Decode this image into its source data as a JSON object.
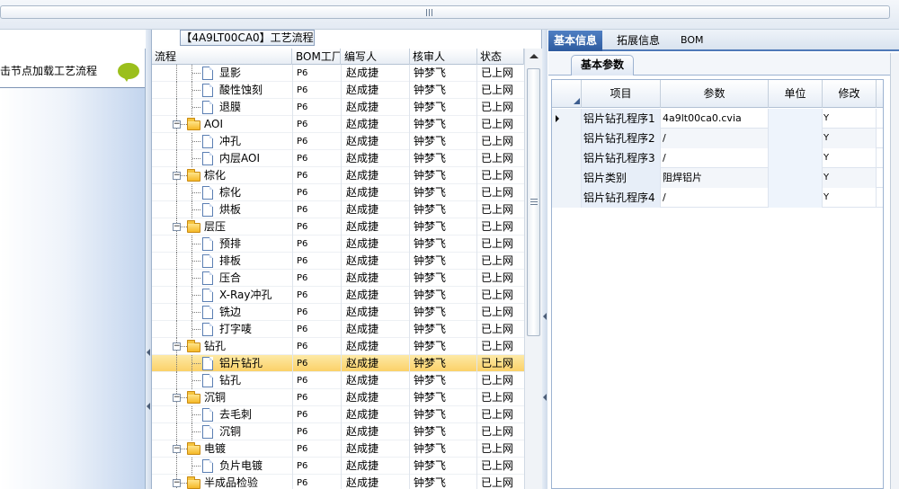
{
  "left": {
    "hint": "击节点加载工艺流程"
  },
  "middle": {
    "title": "【4A9LT00CA0】工艺流程",
    "columns": [
      "流程",
      "BOM工厂",
      "编写人",
      "核审人",
      "状态"
    ],
    "rows": [
      {
        "name": "显影",
        "type": "doc",
        "level": 2,
        "bom": "P6",
        "author": "赵成捷",
        "reviewer": "钟梦飞",
        "status": "已上网"
      },
      {
        "name": "酸性蚀刻",
        "type": "doc",
        "level": 2,
        "bom": "P6",
        "author": "赵成捷",
        "reviewer": "钟梦飞",
        "status": "已上网"
      },
      {
        "name": "退膜",
        "type": "doc",
        "level": 2,
        "bom": "P6",
        "author": "赵成捷",
        "reviewer": "钟梦飞",
        "status": "已上网"
      },
      {
        "name": "AOI",
        "type": "folder",
        "level": 1,
        "bom": "P6",
        "author": "赵成捷",
        "reviewer": "钟梦飞",
        "status": "已上网"
      },
      {
        "name": "冲孔",
        "type": "doc",
        "level": 2,
        "bom": "P6",
        "author": "赵成捷",
        "reviewer": "钟梦飞",
        "status": "已上网"
      },
      {
        "name": "内层AOI",
        "type": "doc",
        "level": 2,
        "bom": "P6",
        "author": "赵成捷",
        "reviewer": "钟梦飞",
        "status": "已上网"
      },
      {
        "name": "棕化",
        "type": "folder",
        "level": 1,
        "bom": "P6",
        "author": "赵成捷",
        "reviewer": "钟梦飞",
        "status": "已上网"
      },
      {
        "name": "棕化",
        "type": "doc",
        "level": 2,
        "bom": "P6",
        "author": "赵成捷",
        "reviewer": "钟梦飞",
        "status": "已上网"
      },
      {
        "name": "烘板",
        "type": "doc",
        "level": 2,
        "bom": "P6",
        "author": "赵成捷",
        "reviewer": "钟梦飞",
        "status": "已上网"
      },
      {
        "name": "层压",
        "type": "folder",
        "level": 1,
        "bom": "P6",
        "author": "赵成捷",
        "reviewer": "钟梦飞",
        "status": "已上网"
      },
      {
        "name": "预排",
        "type": "doc",
        "level": 2,
        "bom": "P6",
        "author": "赵成捷",
        "reviewer": "钟梦飞",
        "status": "已上网"
      },
      {
        "name": "排板",
        "type": "doc",
        "level": 2,
        "bom": "P6",
        "author": "赵成捷",
        "reviewer": "钟梦飞",
        "status": "已上网"
      },
      {
        "name": "压合",
        "type": "doc",
        "level": 2,
        "bom": "P6",
        "author": "赵成捷",
        "reviewer": "钟梦飞",
        "status": "已上网"
      },
      {
        "name": "X-Ray冲孔",
        "type": "doc",
        "level": 2,
        "bom": "P6",
        "author": "赵成捷",
        "reviewer": "钟梦飞",
        "status": "已上网"
      },
      {
        "name": "铣边",
        "type": "doc",
        "level": 2,
        "bom": "P6",
        "author": "赵成捷",
        "reviewer": "钟梦飞",
        "status": "已上网"
      },
      {
        "name": "打字唛",
        "type": "doc",
        "level": 2,
        "bom": "P6",
        "author": "赵成捷",
        "reviewer": "钟梦飞",
        "status": "已上网"
      },
      {
        "name": "钻孔",
        "type": "folder",
        "level": 1,
        "bom": "P6",
        "author": "赵成捷",
        "reviewer": "钟梦飞",
        "status": "已上网"
      },
      {
        "name": "铝片钻孔",
        "type": "doc",
        "level": 2,
        "bom": "P6",
        "author": "赵成捷",
        "reviewer": "钟梦飞",
        "status": "已上网",
        "selected": true
      },
      {
        "name": "钻孔",
        "type": "doc",
        "level": 2,
        "bom": "P6",
        "author": "赵成捷",
        "reviewer": "钟梦飞",
        "status": "已上网"
      },
      {
        "name": "沉铜",
        "type": "folder",
        "level": 1,
        "bom": "P6",
        "author": "赵成捷",
        "reviewer": "钟梦飞",
        "status": "已上网"
      },
      {
        "name": "去毛刺",
        "type": "doc",
        "level": 2,
        "bom": "P6",
        "author": "赵成捷",
        "reviewer": "钟梦飞",
        "status": "已上网"
      },
      {
        "name": "沉铜",
        "type": "doc",
        "level": 2,
        "bom": "P6",
        "author": "赵成捷",
        "reviewer": "钟梦飞",
        "status": "已上网"
      },
      {
        "name": "电镀",
        "type": "folder",
        "level": 1,
        "bom": "P6",
        "author": "赵成捷",
        "reviewer": "钟梦飞",
        "status": "已上网"
      },
      {
        "name": "负片电镀",
        "type": "doc",
        "level": 2,
        "bom": "P6",
        "author": "赵成捷",
        "reviewer": "钟梦飞",
        "status": "已上网"
      },
      {
        "name": "半成品检验",
        "type": "folder",
        "level": 1,
        "bom": "P6",
        "author": "赵成捷",
        "reviewer": "钟梦飞",
        "status": "已上网"
      }
    ]
  },
  "right": {
    "tabs": [
      "基本信息",
      "拓展信息",
      "BOM"
    ],
    "active_tab": 0,
    "subtab": "基本参数",
    "columns": [
      "项目",
      "参数",
      "单位",
      "修改"
    ],
    "rows": [
      {
        "item": "铝片钻孔程序1",
        "param": "4a9lt00ca0.cvia",
        "unit": "",
        "modify": "Y",
        "current": true
      },
      {
        "item": "铝片钻孔程序2",
        "param": "/",
        "unit": "",
        "modify": "Y"
      },
      {
        "item": "铝片钻孔程序3",
        "param": "/",
        "unit": "",
        "modify": "Y"
      },
      {
        "item": "铝片类别",
        "param": "阻焊铝片",
        "unit": "",
        "modify": "Y"
      },
      {
        "item": "铝片钻孔程序4",
        "param": "/",
        "unit": "",
        "modify": "Y"
      }
    ]
  },
  "colors": {
    "accent": "#2d5a9e",
    "selected_row": "#fbd168",
    "folder": "#f5b928"
  },
  "icons": {
    "folder": "folder-icon",
    "doc": "document-icon",
    "comment": "speech-bubble-icon"
  }
}
